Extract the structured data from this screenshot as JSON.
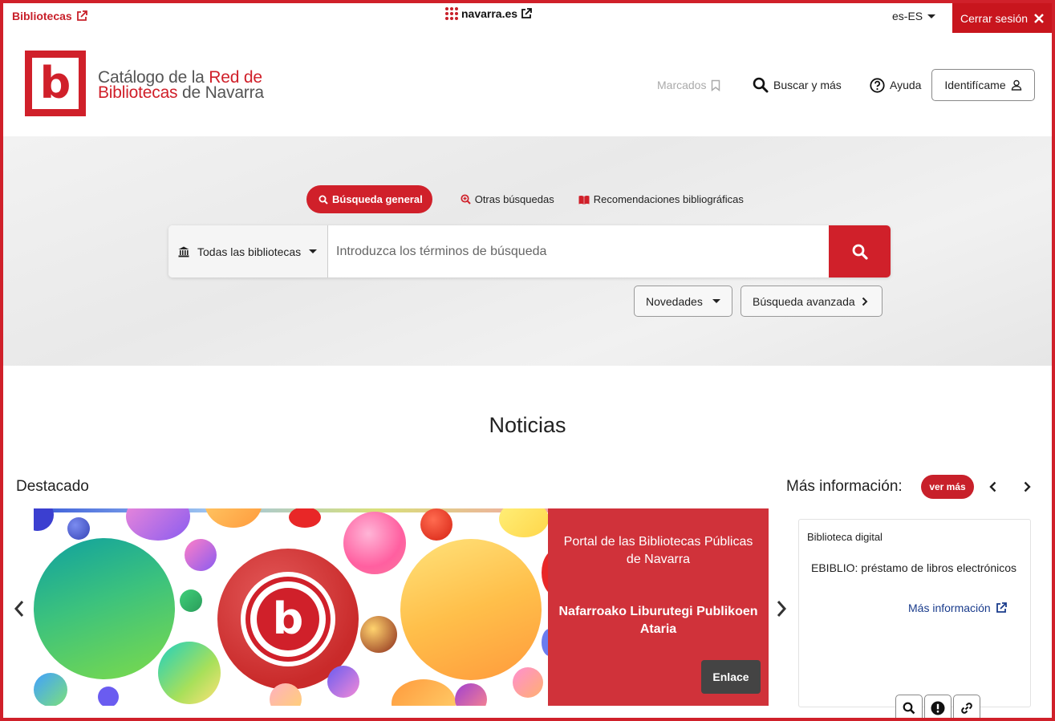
{
  "topbar": {
    "bibliotecas_link": "Bibliotecas",
    "navarra_link": "navarra.es",
    "language": "es-ES",
    "logout_label": "Cerrar sesión"
  },
  "header": {
    "logo_line1_a": "Catálogo de la ",
    "logo_line1_b": "Red de",
    "logo_line2_a": "Bibliotecas",
    "logo_line2_b": " de Navarra",
    "logo_letter": "b",
    "nav_bookmarks": "Marcados",
    "nav_search": "Buscar y más",
    "nav_help": "Ayuda",
    "nav_login": "Identifícame"
  },
  "search": {
    "tabs": [
      {
        "label": "Búsqueda general"
      },
      {
        "label": "Otras búsquedas"
      },
      {
        "label": "Recomendaciones bibliográficas"
      }
    ],
    "library_select": "Todas las bibliotecas",
    "placeholder": "Introduzca los términos de búsqueda",
    "novedades_label": "Novedades",
    "advanced_label": "Búsqueda avanzada"
  },
  "news": {
    "title": "Noticias",
    "featured_label": "Destacado",
    "more_info_label": "Más información:",
    "ver_mas": "ver más",
    "slide": {
      "title_es": "Portal de las Bibliotecas Públicas de Navarra",
      "title_eu": "Nafarroako Liburutegi Publikoen Ataria",
      "link_label": "Enlace"
    },
    "side_card": {
      "category": "Biblioteca digital",
      "description": "EBIBLIO: préstamo de libros electrónicos",
      "link_label": "Más información"
    }
  },
  "colors": {
    "brand_red": "#d0202a",
    "logout_red": "#c8151d",
    "link_blue": "#1a3c8c"
  }
}
